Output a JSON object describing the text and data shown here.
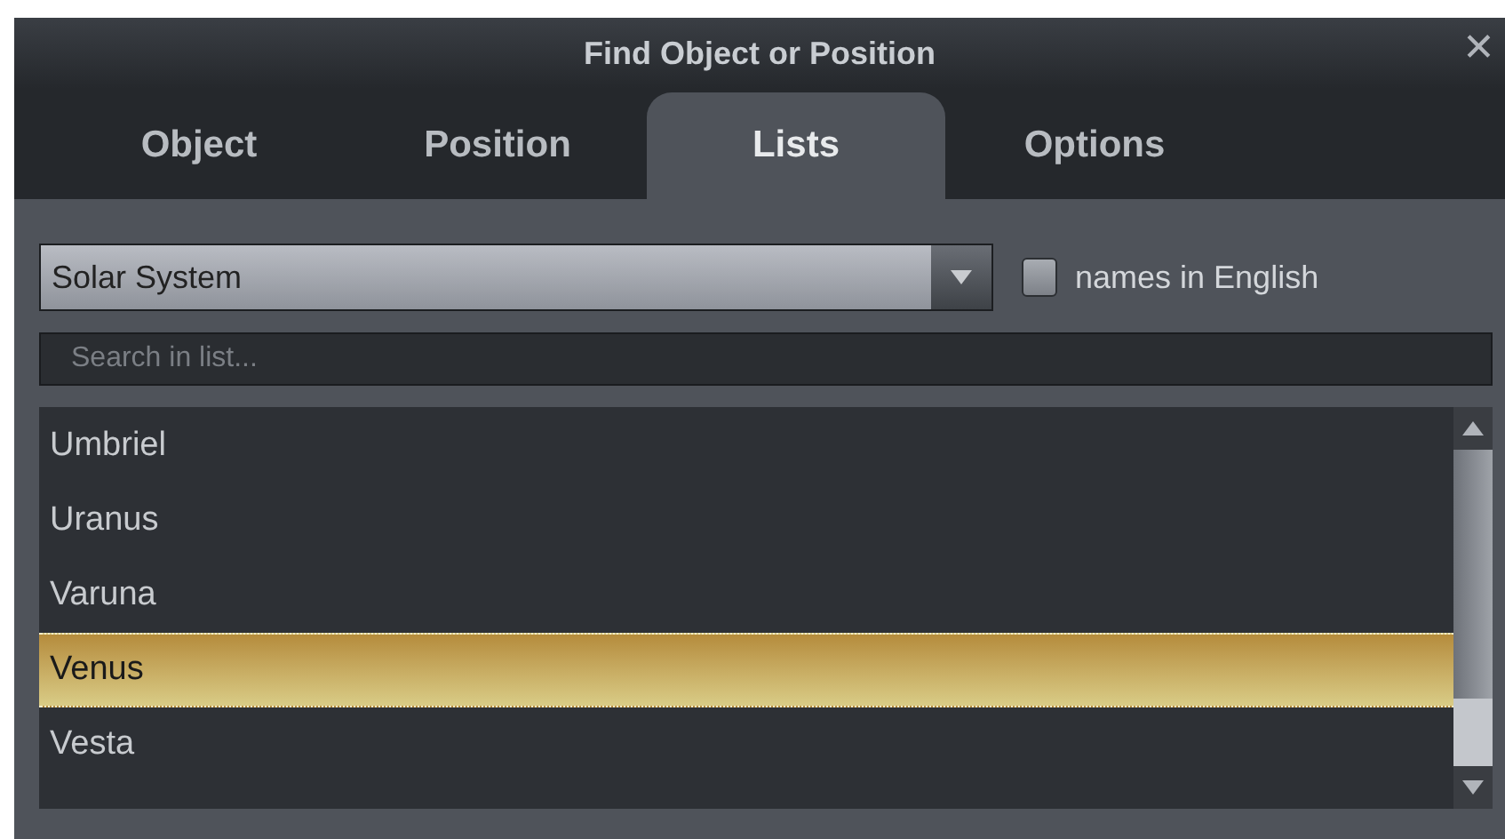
{
  "window": {
    "title": "Find Object or Position",
    "close": "✕"
  },
  "tabs": [
    {
      "label": "Object",
      "selected": false
    },
    {
      "label": "Position",
      "selected": false
    },
    {
      "label": "Lists",
      "selected": true
    },
    {
      "label": "Options",
      "selected": false
    }
  ],
  "list_type": {
    "value": "Solar System"
  },
  "names_in_english": {
    "label": "names in English",
    "checked": false
  },
  "search": {
    "placeholder": "Search in list..."
  },
  "items": [
    {
      "label": "Umbriel",
      "selected": false
    },
    {
      "label": "Uranus",
      "selected": false
    },
    {
      "label": "Varuna",
      "selected": false
    },
    {
      "label": "Venus",
      "selected": true
    },
    {
      "label": "Vesta",
      "selected": false
    }
  ]
}
